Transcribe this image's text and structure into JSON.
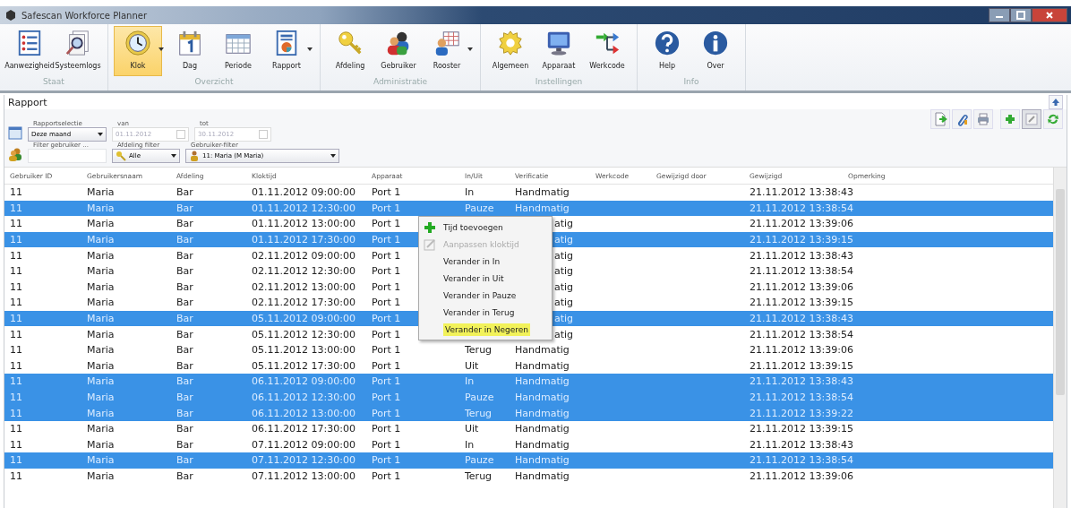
{
  "window": {
    "title": "Safescan Workforce Planner"
  },
  "ribbon": {
    "groups": [
      {
        "label": "Staat",
        "buttons": [
          {
            "label": "Aanwezigheid",
            "selected": false,
            "dropdown": false
          },
          {
            "label": "Systeemlogs",
            "selected": false,
            "dropdown": false
          }
        ]
      },
      {
        "label": "Overzicht",
        "buttons": [
          {
            "label": "Klok",
            "selected": true,
            "dropdown": true
          },
          {
            "label": "Dag",
            "selected": false,
            "dropdown": false
          },
          {
            "label": "Periode",
            "selected": false,
            "dropdown": false
          },
          {
            "label": "Rapport",
            "selected": false,
            "dropdown": true
          }
        ]
      },
      {
        "label": "Administratie",
        "buttons": [
          {
            "label": "Afdeling",
            "selected": false,
            "dropdown": false
          },
          {
            "label": "Gebruiker",
            "selected": false,
            "dropdown": false
          },
          {
            "label": "Rooster",
            "selected": false,
            "dropdown": true
          }
        ]
      },
      {
        "label": "Instellingen",
        "buttons": [
          {
            "label": "Algemeen",
            "selected": false,
            "dropdown": false
          },
          {
            "label": "Apparaat",
            "selected": false,
            "dropdown": false
          },
          {
            "label": "Werkcode",
            "selected": false,
            "dropdown": false
          }
        ]
      },
      {
        "label": "Info",
        "buttons": [
          {
            "label": "Help",
            "selected": false,
            "dropdown": false
          },
          {
            "label": "Over",
            "selected": false,
            "dropdown": false
          }
        ]
      }
    ]
  },
  "panel": {
    "title": "Rapport",
    "filters": {
      "report_selection": {
        "label": "Rapportselectie",
        "value": "Deze maand"
      },
      "from": {
        "label": "van",
        "value": "01.11.2012",
        "disabled": true
      },
      "to": {
        "label": "tot",
        "value": "30.11.2012",
        "disabled": true
      },
      "user_filter_text": {
        "label": "Filter gebruiker ..."
      },
      "department_filter": {
        "label": "Afdeling filter",
        "value": "Alle"
      },
      "user_filter": {
        "label": "Gebruiker-filter",
        "value": "11: Maria (M Maria)"
      }
    }
  },
  "table": {
    "columns": [
      "Gebruiker ID",
      "Gebruikersnaam",
      "Afdeling",
      "Kloktijd",
      "Apparaat",
      "In/Uit",
      "Verificatie",
      "Werkcode",
      "Gewijzigd door",
      "Gewijzigd",
      "Opmerking"
    ],
    "rows": [
      {
        "id": "11",
        "name": "Maria",
        "department": "Bar",
        "clock_time": "01.11.2012 09:00:00",
        "device": "Port 1",
        "in_out": "In",
        "verification": "Handmatig",
        "modified": "21.11.2012 13:38:43",
        "selected": false
      },
      {
        "id": "11",
        "name": "Maria",
        "department": "Bar",
        "clock_time": "01.11.2012 12:30:00",
        "device": "Port 1",
        "in_out": "Pauze",
        "verification": "Handmatig",
        "modified": "21.11.2012 13:38:54",
        "selected": true
      },
      {
        "id": "11",
        "name": "Maria",
        "department": "Bar",
        "clock_time": "01.11.2012 13:00:00",
        "device": "Port 1",
        "verification": "atig",
        "modified": "21.11.2012 13:39:06",
        "selected": false
      },
      {
        "id": "11",
        "name": "Maria",
        "department": "Bar",
        "clock_time": "01.11.2012 17:30:00",
        "device": "Port 1",
        "verification": "atig",
        "modified": "21.11.2012 13:39:15",
        "selected": true
      },
      {
        "id": "11",
        "name": "Maria",
        "department": "Bar",
        "clock_time": "02.11.2012 09:00:00",
        "device": "Port 1",
        "verification": "atig",
        "modified": "21.11.2012 13:38:43",
        "selected": false
      },
      {
        "id": "11",
        "name": "Maria",
        "department": "Bar",
        "clock_time": "02.11.2012 12:30:00",
        "device": "Port 1",
        "verification": "atig",
        "modified": "21.11.2012 13:38:54",
        "selected": false
      },
      {
        "id": "11",
        "name": "Maria",
        "department": "Bar",
        "clock_time": "02.11.2012 13:00:00",
        "device": "Port 1",
        "verification": "atig",
        "modified": "21.11.2012 13:39:06",
        "selected": false
      },
      {
        "id": "11",
        "name": "Maria",
        "department": "Bar",
        "clock_time": "02.11.2012 17:30:00",
        "device": "Port 1",
        "verification": "atig",
        "modified": "21.11.2012 13:39:15",
        "selected": false
      },
      {
        "id": "11",
        "name": "Maria",
        "department": "Bar",
        "clock_time": "05.11.2012 09:00:00",
        "device": "Port 1",
        "verification": "atig",
        "modified": "21.11.2012 13:38:43",
        "selected": true
      },
      {
        "id": "11",
        "name": "Maria",
        "department": "Bar",
        "clock_time": "05.11.2012 12:30:00",
        "device": "Port 1",
        "verification": "atig",
        "modified": "21.11.2012 13:38:54",
        "selected": false
      },
      {
        "id": "11",
        "name": "Maria",
        "department": "Bar",
        "clock_time": "05.11.2012 13:00:00",
        "device": "Port 1",
        "in_out": "Terug",
        "verification": "Handmatig",
        "modified": "21.11.2012 13:39:06",
        "selected": false
      },
      {
        "id": "11",
        "name": "Maria",
        "department": "Bar",
        "clock_time": "05.11.2012 17:30:00",
        "device": "Port 1",
        "in_out": "Uit",
        "verification": "Handmatig",
        "modified": "21.11.2012 13:39:15",
        "selected": false
      },
      {
        "id": "11",
        "name": "Maria",
        "department": "Bar",
        "clock_time": "06.11.2012 09:00:00",
        "device": "Port 1",
        "in_out": "In",
        "verification": "Handmatig",
        "modified": "21.11.2012 13:38:43",
        "selected": true
      },
      {
        "id": "11",
        "name": "Maria",
        "department": "Bar",
        "clock_time": "06.11.2012 12:30:00",
        "device": "Port 1",
        "in_out": "Pauze",
        "verification": "Handmatig",
        "modified": "21.11.2012 13:38:54",
        "selected": true
      },
      {
        "id": "11",
        "name": "Maria",
        "department": "Bar",
        "clock_time": "06.11.2012 13:00:00",
        "device": "Port 1",
        "in_out": "Terug",
        "verification": "Handmatig",
        "modified": "21.11.2012 13:39:22",
        "selected": true
      },
      {
        "id": "11",
        "name": "Maria",
        "department": "Bar",
        "clock_time": "06.11.2012 17:30:00",
        "device": "Port 1",
        "in_out": "Uit",
        "verification": "Handmatig",
        "modified": "21.11.2012 13:39:15",
        "selected": false
      },
      {
        "id": "11",
        "name": "Maria",
        "department": "Bar",
        "clock_time": "07.11.2012 09:00:00",
        "device": "Port 1",
        "in_out": "In",
        "verification": "Handmatig",
        "modified": "21.11.2012 13:38:43",
        "selected": false
      },
      {
        "id": "11",
        "name": "Maria",
        "department": "Bar",
        "clock_time": "07.11.2012 12:30:00",
        "device": "Port 1",
        "in_out": "Pauze",
        "verification": "Handmatig",
        "modified": "21.11.2012 13:38:54",
        "selected": true
      },
      {
        "id": "11",
        "name": "Maria",
        "department": "Bar",
        "clock_time": "07.11.2012 13:00:00",
        "device": "Port 1",
        "in_out": "Terug",
        "verification": "Handmatig",
        "modified": "21.11.2012 13:39:06",
        "selected": false
      }
    ]
  },
  "context_menu": {
    "items": [
      {
        "label": "Tijd toevoegen",
        "disabled": false,
        "highlighted": false
      },
      {
        "label": "Aanpassen kloktijd",
        "disabled": true,
        "highlighted": false
      },
      {
        "label": "Verander in In",
        "disabled": false,
        "highlighted": false
      },
      {
        "label": "Verander in Uit",
        "disabled": false,
        "highlighted": false
      },
      {
        "label": "Verander in Pauze",
        "disabled": false,
        "highlighted": false
      },
      {
        "label": "Verander in Terug",
        "disabled": false,
        "highlighted": false
      },
      {
        "label": "Verander in Negeren",
        "disabled": false,
        "highlighted": true
      }
    ]
  }
}
